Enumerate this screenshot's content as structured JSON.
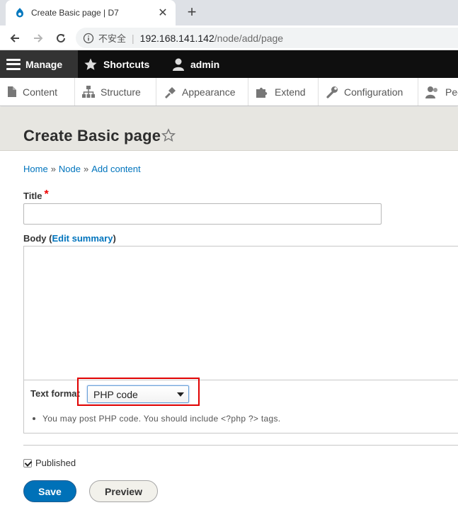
{
  "browser": {
    "tab_title": "Create Basic page | D7",
    "tab_close": "✕",
    "new_tab": "+",
    "security_label": "不安全",
    "url_host": "192.168.141.142",
    "url_path": "/node/add/page"
  },
  "toolbar": {
    "manage": "Manage",
    "shortcuts": "Shortcuts",
    "user": "admin"
  },
  "tray": {
    "content": "Content",
    "structure": "Structure",
    "appearance": "Appearance",
    "extend": "Extend",
    "configuration": "Configuration",
    "people": "Peo"
  },
  "page": {
    "title": "Create Basic page"
  },
  "breadcrumb": {
    "home": "Home",
    "node": "Node",
    "add_content": "Add content",
    "separator": "»"
  },
  "form": {
    "title_label": "Title",
    "required_mark": "*",
    "title_value": "",
    "body_label": "Body",
    "body_open_paren": " (",
    "edit_summary": "Edit summary",
    "body_close_paren": ")",
    "body_value": "",
    "text_format_label": "Text format",
    "text_format_value": "PHP code",
    "text_format_tip": "You may post PHP code. You should include <?php ?> tags.",
    "published_label": "Published",
    "published_checked": true,
    "save_label": "Save",
    "preview_label": "Preview"
  },
  "colors": {
    "toolbar_bg": "#0f0f0f",
    "link": "#0074bd",
    "primary_button": "#0071b8",
    "highlight": "#e00000"
  }
}
